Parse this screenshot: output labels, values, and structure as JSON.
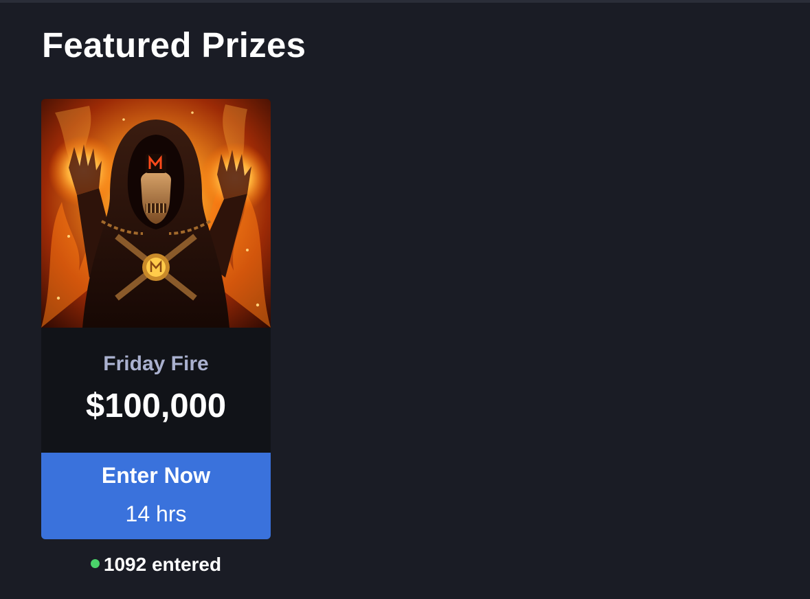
{
  "section": {
    "title": "Featured Prizes"
  },
  "prize_card": {
    "image": {
      "icon": "hooded-flame-skeleton-artwork"
    },
    "name": "Friday Fire",
    "amount": "$100,000",
    "cta": {
      "label": "Enter Now",
      "time_remaining": "14 hrs"
    },
    "entries": {
      "text": "1092 entered",
      "status_color": "#4ad46a"
    }
  },
  "colors": {
    "background": "#1a1c25",
    "card_background": "#111318",
    "accent": "#3a72dc",
    "prize_name": "#aab1cf"
  }
}
